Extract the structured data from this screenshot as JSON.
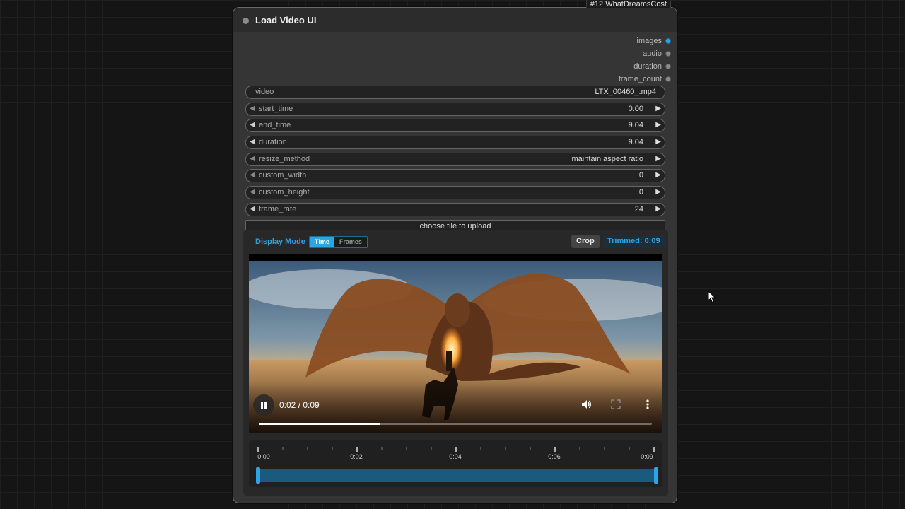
{
  "node": {
    "badge": "#12 WhatDreamsCost",
    "title": "Load Video UI",
    "outputs": [
      "images",
      "audio",
      "duration",
      "frame_count"
    ]
  },
  "widgets": [
    {
      "label": "video",
      "value": "LTX_00460_.mp4"
    },
    {
      "label": "start_time",
      "value": "0.00"
    },
    {
      "label": "end_time",
      "value": "9.04"
    },
    {
      "label": "duration",
      "value": "9.04"
    },
    {
      "label": "resize_method",
      "value": "maintain aspect ratio"
    },
    {
      "label": "custom_width",
      "value": "0"
    },
    {
      "label": "custom_height",
      "value": "0"
    },
    {
      "label": "frame_rate",
      "value": "24"
    }
  ],
  "upload_label": "choose file to upload",
  "player": {
    "mode_label": "Display Mode",
    "mode_options": [
      "Time",
      "Frames"
    ],
    "active_mode": "Time",
    "crop_label": "Crop",
    "trimmed_label": "Trimmed: 0:09",
    "time_display": "0:02 / 0:09",
    "progress": 0.31,
    "video_image": "dragon-rider-desert"
  },
  "timeline": {
    "labels": [
      "0:00",
      "0:02",
      "0:04",
      "0:06",
      "0:09"
    ],
    "trim_start": 0.0,
    "trim_end": 1.0
  },
  "colors": {
    "accent": "#2aa5e8",
    "node_bg": "#353535",
    "canvas_bg": "#151515"
  }
}
